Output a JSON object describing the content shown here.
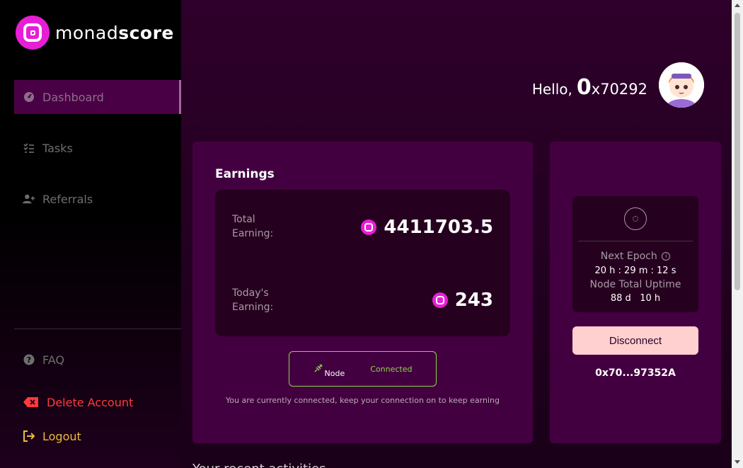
{
  "brand": {
    "name_light": "monad",
    "name_bold": "score",
    "accent": "#e81ed6"
  },
  "sidebar": {
    "items": [
      {
        "label": "Dashboard",
        "icon": "gauge-icon",
        "active": true
      },
      {
        "label": "Tasks",
        "icon": "list-check-icon"
      },
      {
        "label": "Referrals",
        "icon": "user-plus-icon"
      }
    ],
    "footer": [
      {
        "label": "FAQ",
        "icon": "question-circle-icon"
      },
      {
        "label": "Delete Account",
        "icon": "delete-icon"
      },
      {
        "label": "Logout",
        "icon": "logout-icon"
      }
    ]
  },
  "header": {
    "greeting": "Hello,",
    "addr_big": "0",
    "addr_rest": "x70292"
  },
  "earnings": {
    "title": "Earnings",
    "total_label": "Total Earning:",
    "total_value": "4411703.5",
    "today_label": "Today's Earning:",
    "today_value": "243"
  },
  "node": {
    "label": "Node",
    "status": "Connected",
    "note": "You are currently connected, keep your connection on to keep earning",
    "status_color": "#8fd14f"
  },
  "epoch": {
    "next_label": "Next Epoch",
    "next_time": "20 h : 29 m : 12 s",
    "uptime_label": "Node Total Uptime",
    "uptime_value": "88 d   10 h"
  },
  "actions": {
    "disconnect": "Disconnect"
  },
  "wallet": {
    "short": "0x70...97352A"
  },
  "footer_text": "Your recent activities"
}
